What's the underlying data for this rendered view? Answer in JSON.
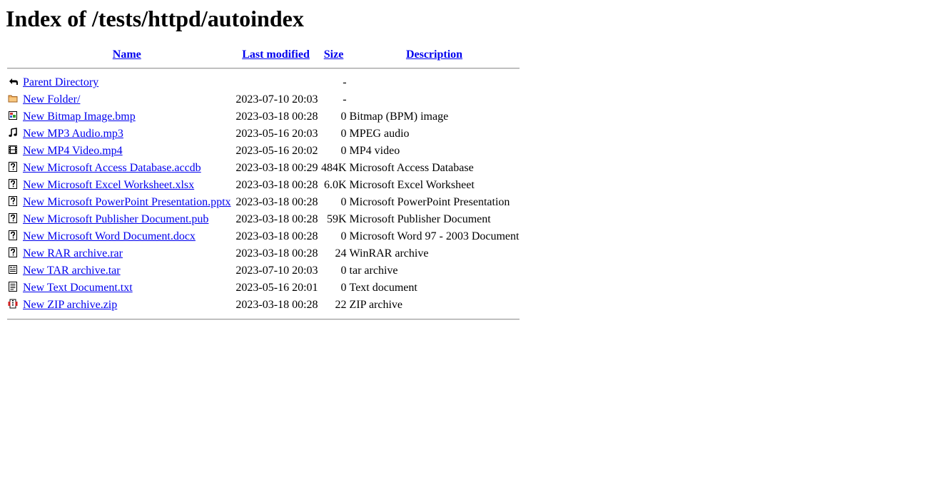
{
  "page": {
    "title": "Index of /tests/httpd/autoindex"
  },
  "columns": {
    "name": "Name",
    "last_modified": "Last modified",
    "size": "Size",
    "description": "Description"
  },
  "parent": {
    "label": "Parent Directory",
    "date": "",
    "size": "-",
    "description": "",
    "icon": "back-icon"
  },
  "entries": [
    {
      "name": "New Folder/",
      "date": "2023-07-10 20:03",
      "size": "-",
      "description": "",
      "icon": "folder-icon"
    },
    {
      "name": "New Bitmap Image.bmp",
      "date": "2023-03-18 00:28",
      "size": "0",
      "description": "Bitmap (BPM) image",
      "icon": "image-icon"
    },
    {
      "name": "New MP3 Audio.mp3",
      "date": "2023-05-16 20:03",
      "size": "0",
      "description": "MPEG audio",
      "icon": "sound-icon"
    },
    {
      "name": "New MP4 Video.mp4",
      "date": "2023-05-16 20:02",
      "size": "0",
      "description": "MP4 video",
      "icon": "movie-icon"
    },
    {
      "name": "New Microsoft Access Database.accdb",
      "date": "2023-03-18 00:29",
      "size": "484K",
      "description": "Microsoft Access Database",
      "icon": "unknown-icon"
    },
    {
      "name": "New Microsoft Excel Worksheet.xlsx",
      "date": "2023-03-18 00:28",
      "size": "6.0K",
      "description": "Microsoft Excel Worksheet",
      "icon": "unknown-icon"
    },
    {
      "name": "New Microsoft PowerPoint Presentation.pptx",
      "date": "2023-03-18 00:28",
      "size": "0",
      "description": "Microsoft PowerPoint Presentation",
      "icon": "unknown-icon"
    },
    {
      "name": "New Microsoft Publisher Document.pub",
      "date": "2023-03-18 00:28",
      "size": "59K",
      "description": "Microsoft Publisher Document",
      "icon": "unknown-icon"
    },
    {
      "name": "New Microsoft Word Document.docx",
      "date": "2023-03-18 00:28",
      "size": "0",
      "description": "Microsoft Word 97 - 2003 Document",
      "icon": "unknown-icon"
    },
    {
      "name": "New RAR archive.rar",
      "date": "2023-03-18 00:28",
      "size": "24",
      "description": "WinRAR archive",
      "icon": "unknown-icon"
    },
    {
      "name": "New TAR archive.tar",
      "date": "2023-07-10 20:03",
      "size": "0",
      "description": "tar archive",
      "icon": "archive-icon"
    },
    {
      "name": "New Text Document.txt",
      "date": "2023-05-16 20:01",
      "size": "0",
      "description": "Text document",
      "icon": "text-icon"
    },
    {
      "name": "New ZIP archive.zip",
      "date": "2023-03-18 00:28",
      "size": "22",
      "description": "ZIP archive",
      "icon": "compressed-icon"
    }
  ],
  "colors": {
    "link": "#0000ee",
    "rule": "#a0a0a0"
  }
}
